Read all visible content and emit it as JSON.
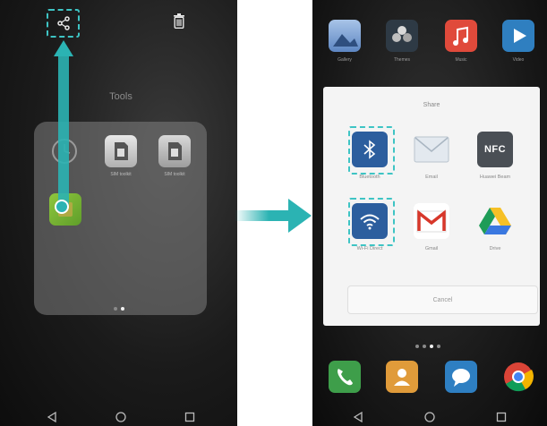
{
  "left_screen": {
    "folder_title": "Tools",
    "apps": [
      {
        "label": "",
        "icon": "clock-icon"
      },
      {
        "label": "SIM toolkit",
        "icon": "sim-card-icon"
      },
      {
        "label": "SIM toolkit",
        "icon": "sim-card-icon"
      },
      {
        "label": "",
        "icon": "app-icon"
      }
    ],
    "top_icons": {
      "share": "share-icon",
      "delete": "trash-icon"
    }
  },
  "right_screen": {
    "top_apps": [
      {
        "label": "Gallery",
        "icon": "gallery-icon"
      },
      {
        "label": "Themes",
        "icon": "themes-icon"
      },
      {
        "label": "Music",
        "icon": "music-icon"
      },
      {
        "label": "Video",
        "icon": "video-icon"
      }
    ],
    "share_sheet": {
      "title": "Share",
      "items": [
        {
          "label": "Bluetooth",
          "icon": "bluetooth-icon"
        },
        {
          "label": "Email",
          "icon": "email-icon"
        },
        {
          "label": "Huawei Beam",
          "icon": "nfc-icon",
          "icon_text": "NFC"
        },
        {
          "label": "Wi-Fi Direct",
          "icon": "wifi-icon"
        },
        {
          "label": "Gmail",
          "icon": "gmail-icon"
        },
        {
          "label": "Drive",
          "icon": "drive-icon"
        }
      ],
      "cancel_label": "Cancel"
    },
    "dock_apps": [
      {
        "icon": "phone-icon"
      },
      {
        "icon": "contacts-icon"
      },
      {
        "icon": "messages-icon"
      },
      {
        "icon": "chrome-icon"
      }
    ]
  },
  "colors": {
    "accent": "#3ec4c4",
    "arrow": "#2bb3b3"
  }
}
